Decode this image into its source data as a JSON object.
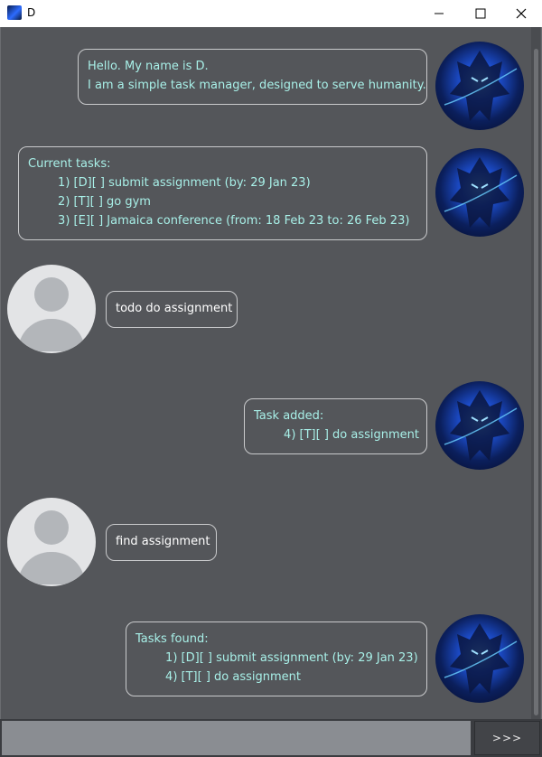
{
  "window": {
    "title": "D"
  },
  "messages": [
    {
      "sender": "bot",
      "text": "Hello. My name is D.\nI am a simple task manager, designed to serve humanity."
    },
    {
      "sender": "bot",
      "text": "Current tasks:\n        1) [D][ ] submit assignment (by: 29 Jan 23)\n        2) [T][ ] go gym\n        3) [E][ ] Jamaica conference (from: 18 Feb 23 to: 26 Feb 23)"
    },
    {
      "sender": "user",
      "text": "todo do assignment"
    },
    {
      "sender": "bot",
      "text": "Task added:\n        4) [T][ ] do assignment"
    },
    {
      "sender": "user",
      "text": "find assignment"
    },
    {
      "sender": "bot",
      "text": "Tasks found:\n        1) [D][ ] submit assignment (by: 29 Jan 23)\n        4) [T][ ] do assignment"
    }
  ],
  "input": {
    "value": "",
    "send_label": ">>>"
  },
  "colors": {
    "background": "#54565a",
    "bot_text": "#a8f0e8",
    "user_text": "#ffffff",
    "input_bg": "#8a8d92"
  },
  "icons": {
    "bot_avatar": "dark-knight-avatar",
    "user_avatar": "default-user-avatar"
  }
}
